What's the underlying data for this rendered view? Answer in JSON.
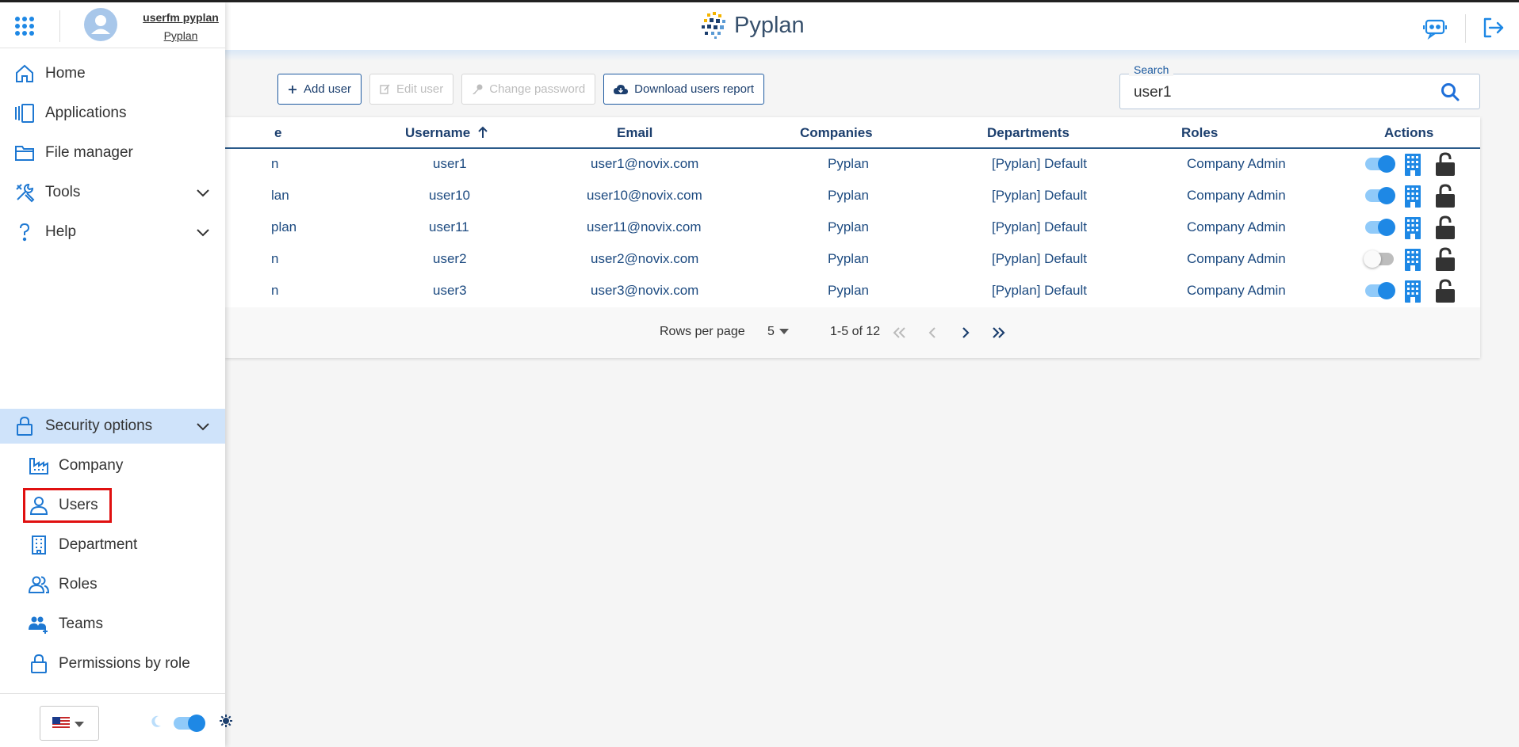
{
  "header": {
    "brand": "Pyplan"
  },
  "user": {
    "name": "userfm pyplan",
    "company": "Pyplan"
  },
  "sidebar": {
    "items": [
      {
        "label": "Home",
        "icon": "home-icon"
      },
      {
        "label": "Applications",
        "icon": "applications-icon"
      },
      {
        "label": "File manager",
        "icon": "folder-icon"
      },
      {
        "label": "Tools",
        "icon": "tools-icon"
      },
      {
        "label": "Help",
        "icon": "help-icon"
      },
      {
        "label": "Security options",
        "icon": "lock-icon"
      }
    ],
    "security_items": [
      {
        "label": "Company",
        "icon": "factory-icon"
      },
      {
        "label": "Users",
        "icon": "user-icon"
      },
      {
        "label": "Department",
        "icon": "building-icon"
      },
      {
        "label": "Roles",
        "icon": "users-icon"
      },
      {
        "label": "Teams",
        "icon": "team-icon"
      },
      {
        "label": "Permissions by role",
        "icon": "lock-icon"
      }
    ]
  },
  "toolbar": {
    "add_user": "Add user",
    "edit_user": "Edit user",
    "change_password": "Change password",
    "download_report": "Download users report"
  },
  "search": {
    "label": "Search",
    "value": "user1"
  },
  "table": {
    "columns": {
      "name_partial": "e",
      "username": "Username",
      "email": "Email",
      "companies": "Companies",
      "departments": "Departments",
      "roles": "Roles",
      "actions": "Actions"
    },
    "rows": [
      {
        "name_partial": "n",
        "username": "user1",
        "email": "user1@novix.com",
        "company": "Pyplan",
        "department": "[Pyplan] Default",
        "role": "Company Admin",
        "active": true
      },
      {
        "name_partial": "lan",
        "username": "user10",
        "email": "user10@novix.com",
        "company": "Pyplan",
        "department": "[Pyplan] Default",
        "role": "Company Admin",
        "active": true
      },
      {
        "name_partial": "plan",
        "username": "user11",
        "email": "user11@novix.com",
        "company": "Pyplan",
        "department": "[Pyplan] Default",
        "role": "Company Admin",
        "active": true
      },
      {
        "name_partial": "n",
        "username": "user2",
        "email": "user2@novix.com",
        "company": "Pyplan",
        "department": "[Pyplan] Default",
        "role": "Company Admin",
        "active": false
      },
      {
        "name_partial": "n",
        "username": "user3",
        "email": "user3@novix.com",
        "company": "Pyplan",
        "department": "[Pyplan] Default",
        "role": "Company Admin",
        "active": true
      }
    ]
  },
  "pagination": {
    "rows_per_page_label": "Rows per page",
    "rows_per_page": "5",
    "range": "1-5 of 12"
  },
  "colors": {
    "accent": "#1e88e5",
    "active_nav": "#cfe3fa",
    "highlight_box": "#e01010"
  }
}
